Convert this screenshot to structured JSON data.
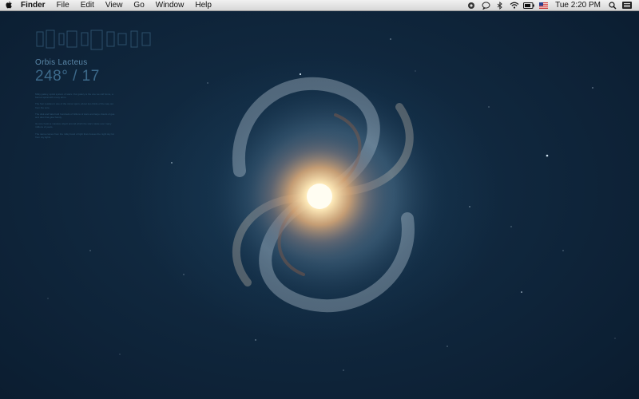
{
  "menubar": {
    "app_name": "Finder",
    "menus": [
      "File",
      "Edit",
      "View",
      "Go",
      "Window",
      "Help"
    ],
    "clock": "Tue 2:20 PM",
    "tray_icons": [
      "compass-icon",
      "chat-bubble-icon",
      "bluetooth-icon",
      "wifi-icon",
      "battery-icon",
      "flag-icon",
      "search-icon",
      "list-icon"
    ]
  },
  "wallpaper": {
    "title": "Orbis Lacteus",
    "coords": "248° / 17",
    "paragraphs": [
      "Milky galaxy, spiral system of stars. Our galaxy is the one we call home, a barred spiral with many arms.",
      "The Sun resides in one of the minor spurs, about two thirds of the way out from the core.",
      "The disk and halo hold hundreds of billions of stars and large clouds of gas and dust that glow faintly.",
      "Its core hosts a massive object around which the stars rotate over many millions of years.",
      "The name comes from the milky band of light that crosses the night sky far from city lights."
    ]
  }
}
